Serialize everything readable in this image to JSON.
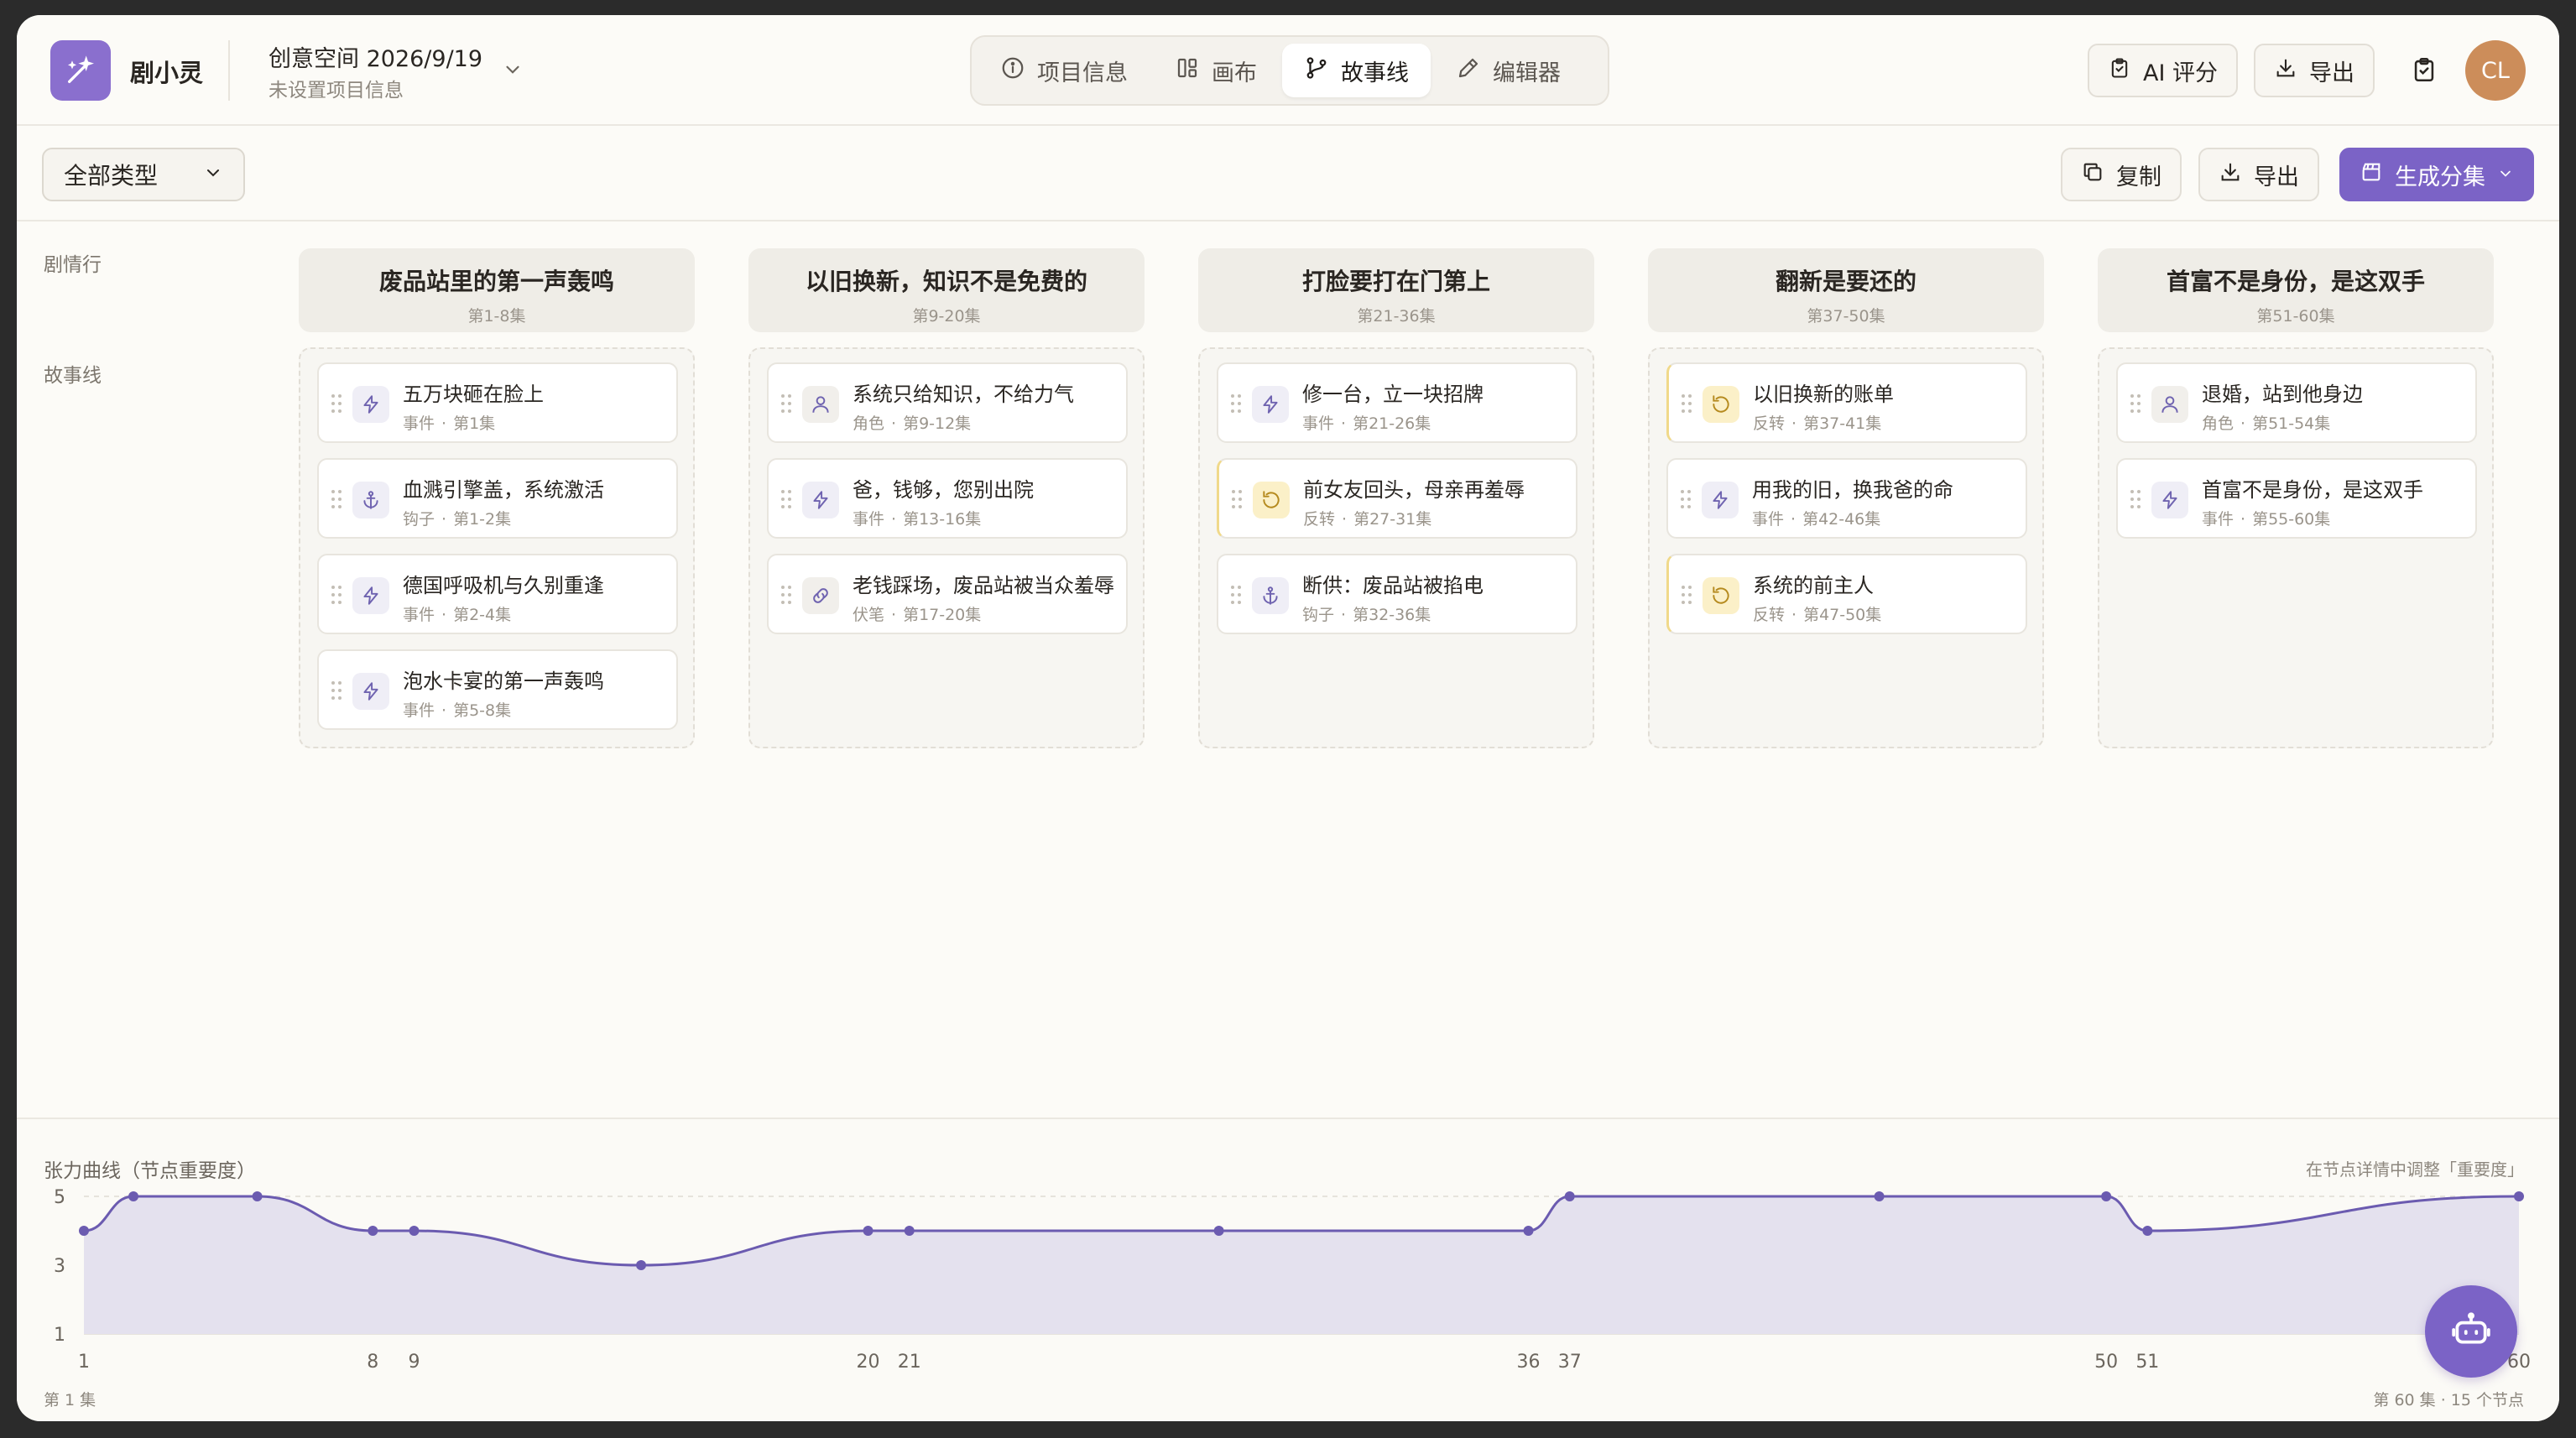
{
  "app": {
    "name": "剧小灵"
  },
  "project": {
    "title": "创意空间 2026/9/19",
    "subtitle": "未设置项目信息"
  },
  "tabs": [
    {
      "label": "项目信息",
      "icon": "info-icon",
      "active": false
    },
    {
      "label": "画布",
      "icon": "layout-icon",
      "active": false
    },
    {
      "label": "故事线",
      "icon": "branch-icon",
      "active": true
    },
    {
      "label": "编辑器",
      "icon": "pencil-icon",
      "active": false
    }
  ],
  "header_actions": {
    "ai_score": "AI 评分",
    "export": "导出",
    "avatar": "CL"
  },
  "toolbar": {
    "filter_value": "全部类型",
    "copy": "复制",
    "export": "导出",
    "generate": "生成分集"
  },
  "rows": {
    "arc_label": "剧情行",
    "storyline_label": "故事线"
  },
  "arcs": [
    {
      "title": "废品站里的第一声轰鸣",
      "range": "第1-8集",
      "cards": [
        {
          "title": "五万块砸在脸上",
          "type": "事件",
          "episodes": "第1集",
          "icon": "bolt-icon"
        },
        {
          "title": "血溅引擎盖，系统激活",
          "type": "钩子",
          "episodes": "第1-2集",
          "icon": "anchor-icon"
        },
        {
          "title": "德国呼吸机与久别重逢",
          "type": "事件",
          "episodes": "第2-4集",
          "icon": "bolt-icon"
        },
        {
          "title": "泡水卡宴的第一声轰鸣",
          "type": "事件",
          "episodes": "第5-8集",
          "icon": "bolt-icon"
        }
      ]
    },
    {
      "title": "以旧换新，知识不是免费的",
      "range": "第9-20集",
      "cards": [
        {
          "title": "系统只给知识，不给力气",
          "type": "角色",
          "episodes": "第9-12集",
          "icon": "user-icon"
        },
        {
          "title": "爸，钱够，您别出院",
          "type": "事件",
          "episodes": "第13-16集",
          "icon": "bolt-icon"
        },
        {
          "title": "老钱踩场，废品站被当众羞辱",
          "type": "伏笔",
          "episodes": "第17-20集",
          "icon": "link-icon"
        }
      ]
    },
    {
      "title": "打脸要打在门第上",
      "range": "第21-36集",
      "cards": [
        {
          "title": "修一台，立一块招牌",
          "type": "事件",
          "episodes": "第21-26集",
          "icon": "bolt-icon"
        },
        {
          "title": "前女友回头，母亲再羞辱",
          "type": "反转",
          "episodes": "第27-31集",
          "icon": "rotate-icon"
        },
        {
          "title": "断供：废品站被掐电",
          "type": "钩子",
          "episodes": "第32-36集",
          "icon": "anchor-icon"
        }
      ]
    },
    {
      "title": "翻新是要还的",
      "range": "第37-50集",
      "cards": [
        {
          "title": "以旧换新的账单",
          "type": "反转",
          "episodes": "第37-41集",
          "icon": "rotate-icon"
        },
        {
          "title": "用我的旧，换我爸的命",
          "type": "事件",
          "episodes": "第42-46集",
          "icon": "bolt-icon"
        },
        {
          "title": "系统的前主人",
          "type": "反转",
          "episodes": "第47-50集",
          "icon": "rotate-icon"
        }
      ]
    },
    {
      "title": "首富不是身份，是这双手",
      "range": "第51-60集",
      "cards": [
        {
          "title": "退婚，站到他身边",
          "type": "角色",
          "episodes": "第51-54集",
          "icon": "user-icon"
        },
        {
          "title": "首富不是身份，是这双手",
          "type": "事件",
          "episodes": "第55-60集",
          "icon": "bolt-icon"
        }
      ]
    }
  ],
  "tension": {
    "title": "张力曲线（节点重要度）",
    "hint": "在节点详情中调整「重要度」",
    "start_label": "第 1 集",
    "end_label": "第 60 集 · 15 个节点"
  },
  "chart_data": {
    "type": "area",
    "x": [
      1,
      2.2,
      5.2,
      8,
      9,
      14.5,
      20,
      21,
      28.5,
      36,
      37,
      44.5,
      50,
      51,
      60
    ],
    "y": [
      4,
      5,
      5,
      4,
      4,
      3,
      4,
      4,
      4,
      4,
      5,
      5,
      5,
      4,
      5
    ],
    "x_tick_labels": [
      "1",
      "8",
      "9",
      "20",
      "21",
      "36",
      "37",
      "50",
      "51",
      "60"
    ],
    "y_ticks": [
      1,
      3,
      5
    ],
    "ylim": [
      1,
      5
    ],
    "xlim": [
      1,
      60
    ],
    "color": "#6b5bb0",
    "fill": "#e4e1ee"
  },
  "colors": {
    "accent": "#7b63c6",
    "reversal": "#f0d98a",
    "icon_stroke": "#6f63b0"
  }
}
